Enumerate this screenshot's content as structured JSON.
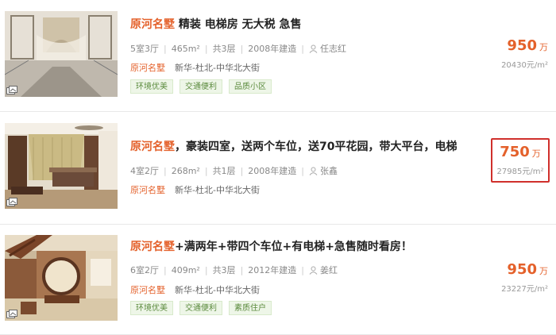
{
  "listings": [
    {
      "title_community": "原河名墅",
      "title_rest": " 精装 电梯房 无大税 急售",
      "layout": "5室3厅",
      "area": "465m²",
      "floors": "共3层",
      "built": "2008年建造",
      "agent": "任志红",
      "community": "原河名墅",
      "address": "新华-杜北-中华北大街",
      "tags": [
        "环境优美",
        "交通便利",
        "品质小区"
      ],
      "price": "950",
      "price_unit": "万",
      "unit_price": "20430元/m²"
    },
    {
      "title_community": "原河名墅",
      "title_rest": "，豪装四室，送两个车位，送70平花园，带大平台，电梯",
      "layout": "4室2厅",
      "area": "268m²",
      "floors": "共1层",
      "built": "2008年建造",
      "agent": "张鑫",
      "community": "原河名墅",
      "address": "新华-杜北-中华北大街",
      "tags": [],
      "price": "750",
      "price_unit": "万",
      "unit_price": "27985元/m²",
      "highlighted": true
    },
    {
      "title_community": "原河名墅",
      "title_rest": "+满两年+带四个车位+有电梯+急售随时看房！",
      "layout": "6室2厅",
      "area": "409m²",
      "floors": "共3层",
      "built": "2012年建造",
      "agent": "姜红",
      "community": "原河名墅",
      "address": "新华-杜北-中华北大街",
      "tags": [
        "环境优美",
        "交通便利",
        "素质住户"
      ],
      "price": "950",
      "price_unit": "万",
      "unit_price": "23227元/m²"
    }
  ],
  "colors": {
    "accent": "#e4612b",
    "highlight_border": "#d0302c",
    "tag_text": "#5a8a3c",
    "tag_bg": "#eef6e8"
  },
  "icons": {
    "agent": "person-icon",
    "photo": "gallery-icon"
  }
}
